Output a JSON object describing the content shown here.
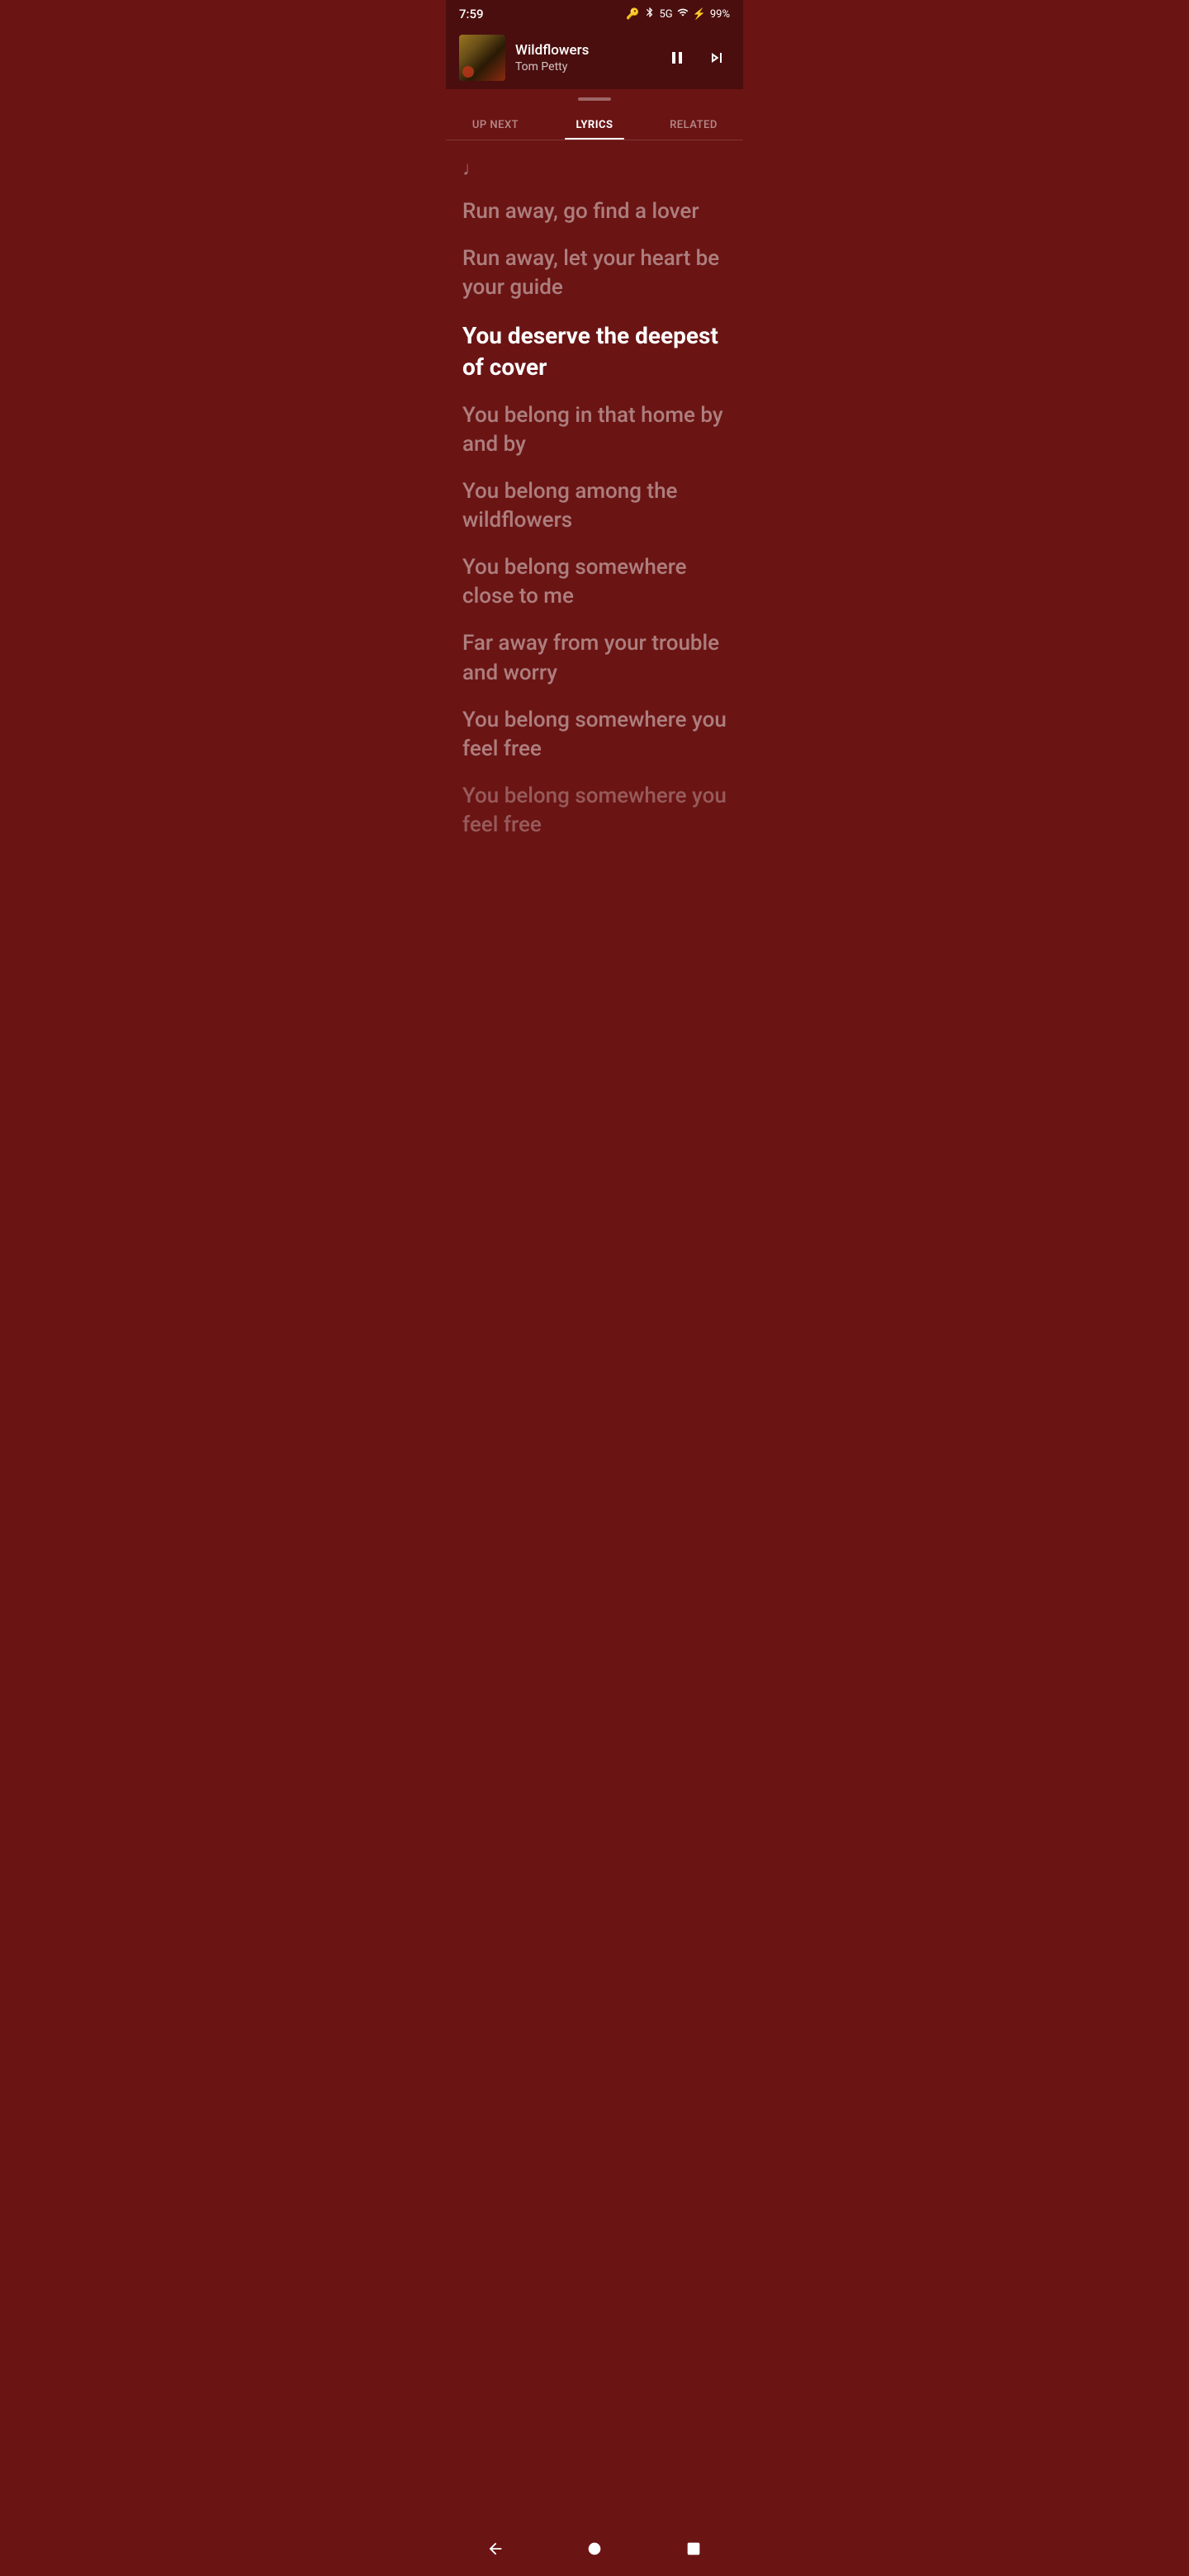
{
  "statusBar": {
    "time": "7:59",
    "network": "5G",
    "battery": "99%"
  },
  "nowPlaying": {
    "title": "Wildflowers",
    "artist": "Tom Petty"
  },
  "tabs": [
    {
      "id": "up-next",
      "label": "UP NEXT",
      "active": false
    },
    {
      "id": "lyrics",
      "label": "LYRICS",
      "active": true
    },
    {
      "id": "related",
      "label": "RELATED",
      "active": false
    }
  ],
  "lyrics": {
    "lines": [
      {
        "text": "Run away, go find a lover",
        "state": "past"
      },
      {
        "text": "Run away, let your heart be your guide",
        "state": "past"
      },
      {
        "text": "You deserve the deepest of cover",
        "state": "active"
      },
      {
        "text": "You belong in that home by and by",
        "state": "upcoming"
      },
      {
        "text": "You belong among the wildflowers",
        "state": "upcoming"
      },
      {
        "text": "You belong somewhere close to me",
        "state": "upcoming"
      },
      {
        "text": "Far away from your trouble and worry",
        "state": "upcoming"
      },
      {
        "text": "You belong somewhere you feel free",
        "state": "upcoming"
      },
      {
        "text": "You belong somewhere you feel free",
        "state": "fading"
      }
    ]
  }
}
